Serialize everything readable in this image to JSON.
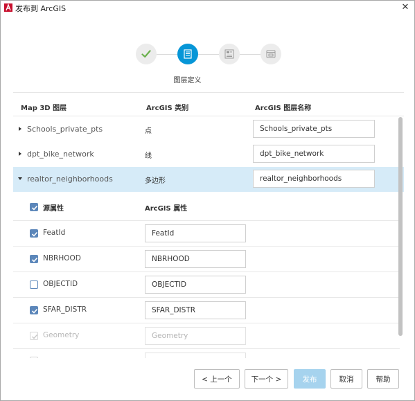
{
  "window": {
    "title": "发布到 ArcGIS",
    "close_glyph": "✕"
  },
  "stepper": {
    "steps": [
      {
        "name": "done",
        "icon": "check-icon",
        "state": "complete"
      },
      {
        "name": "layer-definition",
        "icon": "document-icon",
        "state": "active"
      },
      {
        "name": "settings",
        "icon": "layout-icon",
        "state": "pending"
      },
      {
        "name": "publish",
        "icon": "window-icon",
        "state": "pending"
      }
    ],
    "active_label": "图层定义"
  },
  "table": {
    "headers": {
      "layer": "Map 3D 图层",
      "category": "ArcGIS 类别",
      "arcgis_name": "ArcGIS 图层名称"
    },
    "rows": [
      {
        "name": "Schools_private_pts",
        "category": "点",
        "arcgis_name": "Schools_private_pts",
        "expanded": false
      },
      {
        "name": "dpt_bike_network",
        "category": "线",
        "arcgis_name": "dpt_bike_network",
        "expanded": false
      },
      {
        "name": "realtor_neighborhoods",
        "category": "多边形",
        "arcgis_name": "realtor_neighborhoods",
        "expanded": true
      }
    ]
  },
  "attributes": {
    "source_header": "源属性",
    "arcgis_header": "ArcGIS 属性",
    "items": [
      {
        "name": "FeatId",
        "value": "FeatId",
        "checked": true,
        "enabled": true
      },
      {
        "name": "NBRHOOD",
        "value": "NBRHOOD",
        "checked": true,
        "enabled": true
      },
      {
        "name": "OBJECTID",
        "value": "OBJECTID",
        "checked": false,
        "enabled": true
      },
      {
        "name": "SFAR_DISTR",
        "value": "SFAR_DISTR",
        "checked": true,
        "enabled": true
      },
      {
        "name": "Geometry",
        "value": "Geometry",
        "checked": true,
        "enabled": false
      }
    ]
  },
  "buttons": {
    "prev": "< 上一个",
    "next": "下一个 >",
    "publish": "发布",
    "cancel": "取消",
    "help": "帮助"
  },
  "colors": {
    "accent": "#0696d7",
    "selected_row": "#d6ebf8",
    "checkbox": "#5c87ba",
    "done_check": "#6ab04c"
  }
}
